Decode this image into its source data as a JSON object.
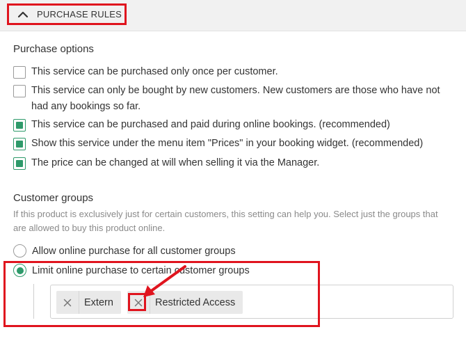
{
  "header": {
    "title": "PURCHASE RULES",
    "toggle_icon": "chevron-up-icon"
  },
  "purchase_options": {
    "title": "Purchase options",
    "options": [
      {
        "label": "This service can be purchased only once per customer.",
        "checked": false
      },
      {
        "label": "This service can only be bought by new customers. New customers are those who have not had any bookings so far.",
        "checked": false
      },
      {
        "label": "This service can be purchased and paid during online bookings. (recommended)",
        "checked": true
      },
      {
        "label": "Show this service under the menu item \"Prices\" in your booking widget. (recommended)",
        "checked": true
      },
      {
        "label": "The price can be changed at will when selling it via the Manager.",
        "checked": true
      }
    ]
  },
  "customer_groups": {
    "title": "Customer groups",
    "description": "If this product is exclusively just for certain customers, this setting can help you. Select just the groups that are allowed to buy this product online.",
    "radios": [
      {
        "label": "Allow online purchase for all customer groups",
        "selected": false
      },
      {
        "label": "Limit online purchase to certain customer groups",
        "selected": true
      }
    ],
    "selected_groups": [
      {
        "label": "Extern"
      },
      {
        "label": "Restricted Access"
      }
    ]
  },
  "colors": {
    "accent_green": "#2e9a6a",
    "annotation_red": "#e0141e",
    "muted_text": "#8a8a8a",
    "header_bg": "#f1f1f1"
  }
}
